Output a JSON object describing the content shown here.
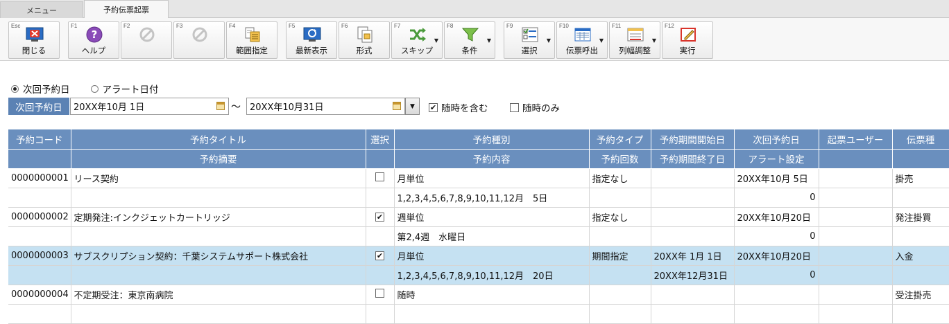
{
  "tabs": {
    "menu": "メニュー",
    "active": "予約伝票起票"
  },
  "toolbar": [
    {
      "key": "Esc",
      "label": "閉じる",
      "icon": "close-icon",
      "disabled": false,
      "dropdown": false
    },
    {
      "key": "F1",
      "label": "ヘルプ",
      "icon": "help-icon",
      "disabled": false,
      "dropdown": false
    },
    {
      "key": "F2",
      "label": "",
      "icon": "disabled-icon",
      "disabled": true,
      "dropdown": false
    },
    {
      "key": "F3",
      "label": "",
      "icon": "disabled-icon",
      "disabled": true,
      "dropdown": false
    },
    {
      "key": "F4",
      "label": "範囲指定",
      "icon": "range-icon",
      "disabled": false,
      "dropdown": false
    },
    {
      "key": "F5",
      "label": "最新表示",
      "icon": "refresh-icon",
      "disabled": false,
      "dropdown": false
    },
    {
      "key": "F6",
      "label": "形式",
      "icon": "format-icon",
      "disabled": false,
      "dropdown": false
    },
    {
      "key": "F7",
      "label": "スキップ",
      "icon": "skip-icon",
      "disabled": false,
      "dropdown": true
    },
    {
      "key": "F8",
      "label": "条件",
      "icon": "filter-icon",
      "disabled": false,
      "dropdown": true
    },
    {
      "key": "F9",
      "label": "選択",
      "icon": "select-icon",
      "disabled": false,
      "dropdown": true
    },
    {
      "key": "F10",
      "label": "伝票呼出",
      "icon": "slip-icon",
      "disabled": false,
      "dropdown": true
    },
    {
      "key": "F11",
      "label": "列幅調整",
      "icon": "column-width-icon",
      "disabled": false,
      "dropdown": true
    },
    {
      "key": "F12",
      "label": "実行",
      "icon": "execute-icon",
      "disabled": false,
      "dropdown": false
    }
  ],
  "radios": {
    "next": "次回予約日",
    "alert": "アラート日付"
  },
  "filter": {
    "label": "次回予約日",
    "from": "20XX年10月 1日",
    "tilde": "～",
    "to": "20XX年10月31日",
    "include_adhoc": "随時を含む",
    "adhoc_only": "随時のみ"
  },
  "columns": {
    "code": "予約コード",
    "title": "予約タイトル",
    "select": "選択",
    "kind": "予約種別",
    "type": "予約タイプ",
    "start": "予約期間開始日",
    "next": "次回予約日",
    "user": "起票ユーザー",
    "slip": "伝票種",
    "summary": "予約摘要",
    "content": "予約内容",
    "count": "予約回数",
    "end": "予約期間終了日",
    "alert": "アラート設定"
  },
  "rows": [
    {
      "code": "0000000001",
      "title": "リース契約",
      "checked": false,
      "kind": "月単位",
      "content": "1,2,3,4,5,6,7,8,9,10,11,12月　5日",
      "type": "指定なし",
      "start": "",
      "end": "",
      "next": "20XX年10月 5日",
      "alert": "0",
      "user": "",
      "slip": "掛売",
      "selected": false
    },
    {
      "code": "0000000002",
      "title": "定期発注:インクジェットカートリッジ",
      "checked": true,
      "kind": "週単位",
      "content": "第2,4週　水曜日",
      "type": "指定なし",
      "start": "",
      "end": "",
      "next": "20XX年10月20日",
      "alert": "0",
      "user": "",
      "slip": "発注掛買",
      "selected": false
    },
    {
      "code": "0000000003",
      "title": "サブスクリプション契約：千葉システムサポート株式会社",
      "checked": true,
      "kind": "月単位",
      "content": "1,2,3,4,5,6,7,8,9,10,11,12月　20日",
      "type": "期間指定",
      "start": "20XX年 1月 1日",
      "end": "20XX年12月31日",
      "next": "20XX年10月20日",
      "alert": "0",
      "user": "",
      "slip": "入金",
      "selected": true
    },
    {
      "code": "0000000004",
      "title": "不定期受注：東京南病院",
      "checked": false,
      "kind": "随時",
      "content": "",
      "type": "",
      "start": "",
      "end": "",
      "next": "",
      "alert": "",
      "user": "",
      "slip": "受注掛売",
      "selected": false
    }
  ]
}
